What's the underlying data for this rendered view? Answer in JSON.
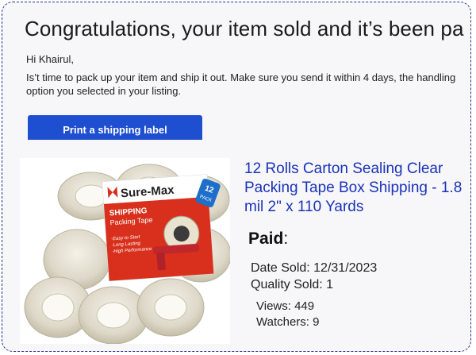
{
  "email": {
    "headline": "Congratulations, your item sold and it’s been paid for",
    "greeting": "Hi Khairul,",
    "message": "Is’t time to pack up your item and ship it out. Make sure you send it within 4 days, the handling option you selected in your listing.",
    "ship_button_label": "Print a shipping label"
  },
  "product": {
    "title": "12 Rolls Carton Sealing Clear Packing Tape Box Shipping - 1.8 mil 2\" x 110 Yards",
    "image": {
      "brand": "Sure-Max",
      "box_label_line1": "SHIPPING",
      "box_label_line2": "Packing Tape",
      "features": [
        "·Easy to Start",
        "·Long Lasting",
        "·High Performance"
      ],
      "badge_number": "12",
      "badge_text": "PACK"
    }
  },
  "sale": {
    "paid_label": "Paid",
    "paid_colon": ":",
    "date_sold": "Date Sold: 12/31/2023",
    "quality_sold": "Quality Sold: 1",
    "views": "Views: 449",
    "watchers": "Watchers: 9"
  },
  "colors": {
    "frame_border": "#2b2f8a",
    "button_blue": "#1f4fd1",
    "title_blue": "#1a32b8",
    "brand_red": "#d8301c"
  }
}
